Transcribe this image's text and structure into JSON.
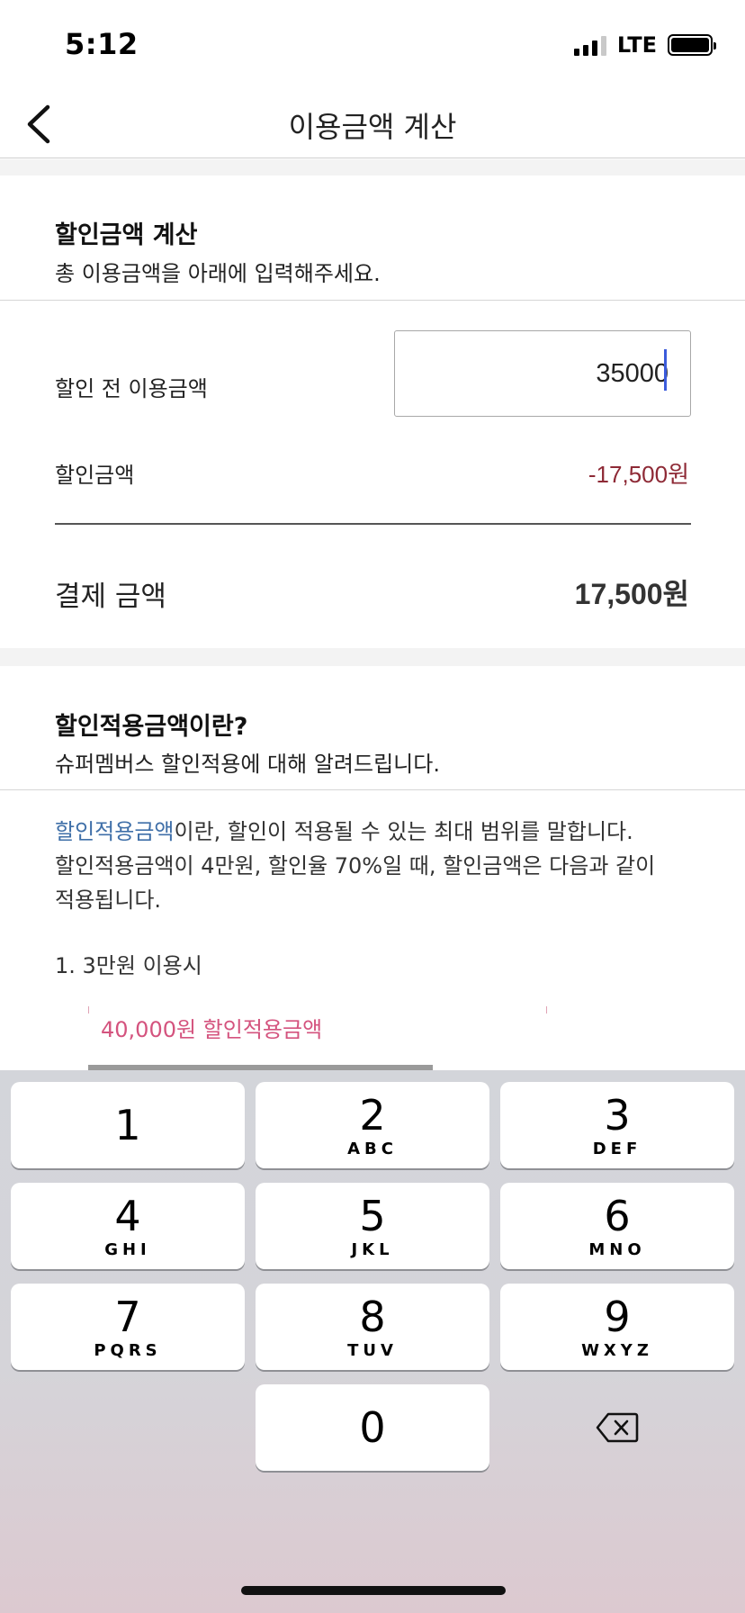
{
  "status_bar": {
    "time": "5:12",
    "network": "LTE"
  },
  "nav": {
    "title": "이용금액 계산"
  },
  "calc_section": {
    "title": "할인금액 계산",
    "subtitle": "총 이용금액을 아래에 입력해주세요.",
    "pre_discount_label": "할인 전 이용금액",
    "pre_discount_value": "35000",
    "discount_label": "할인금액",
    "discount_value": "-17,500원",
    "payment_label": "결제 금액",
    "payment_value": "17,500원"
  },
  "info_section": {
    "title": "할인적용금액이란?",
    "subtitle": "슈퍼멤버스 할인적용에 대해 알려드립니다.",
    "highlight": "할인적용금액",
    "line1_rest": "이란, 할인이 적용될 수 있는 최대 범위를 말합니다.",
    "line2": "할인적용금액이 4만원, 할인율 70%일 때, 할인금액은 다음과 같이",
    "line3": "적용됩니다.",
    "step1": "1. 3만원 이용시",
    "diagram_label": "40,000원 할인적용금액"
  },
  "keyboard": {
    "keys": [
      {
        "num": "1",
        "letters": ""
      },
      {
        "num": "2",
        "letters": "ABC"
      },
      {
        "num": "3",
        "letters": "DEF"
      },
      {
        "num": "4",
        "letters": "GHI"
      },
      {
        "num": "5",
        "letters": "JKL"
      },
      {
        "num": "6",
        "letters": "MNO"
      },
      {
        "num": "7",
        "letters": "PQRS"
      },
      {
        "num": "8",
        "letters": "TUV"
      },
      {
        "num": "9",
        "letters": "WXYZ"
      },
      {
        "num": "0",
        "letters": ""
      }
    ],
    "delete_icon": "backspace-icon"
  },
  "colors": {
    "discount_red": "#8e2a36",
    "link_blue": "#3f6fa8",
    "pink": "#d4537e",
    "caret_blue": "#3b5bdb"
  }
}
